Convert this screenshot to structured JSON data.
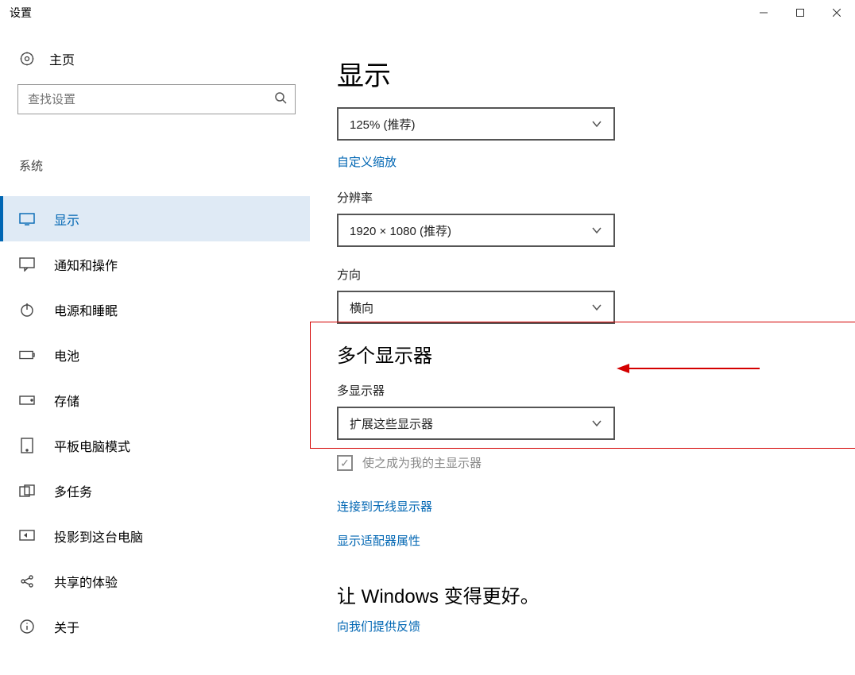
{
  "window": {
    "title": "设置"
  },
  "sidebar": {
    "home": "主页",
    "search_placeholder": "查找设置",
    "category": "系统",
    "items": [
      {
        "label": "显示",
        "icon": "monitor-icon",
        "active": true
      },
      {
        "label": "通知和操作",
        "icon": "message-icon"
      },
      {
        "label": "电源和睡眠",
        "icon": "power-icon"
      },
      {
        "label": "电池",
        "icon": "battery-icon"
      },
      {
        "label": "存储",
        "icon": "storage-icon"
      },
      {
        "label": "平板电脑模式",
        "icon": "tablet-icon"
      },
      {
        "label": "多任务",
        "icon": "multitask-icon"
      },
      {
        "label": "投影到这台电脑",
        "icon": "project-icon"
      },
      {
        "label": "共享的体验",
        "icon": "share-icon"
      },
      {
        "label": "关于",
        "icon": "info-icon"
      }
    ]
  },
  "main": {
    "title": "显示",
    "scale_value": "125% (推荐)",
    "custom_scaling_link": "自定义缩放",
    "resolution_label": "分辨率",
    "resolution_value": "1920 × 1080 (推荐)",
    "orientation_label": "方向",
    "orientation_value": "横向",
    "multi_heading": "多个显示器",
    "multi_label": "多显示器",
    "multi_value": "扩展这些显示器",
    "make_main_label": "使之成为我的主显示器",
    "connect_link": "连接到无线显示器",
    "adapter_link": "显示适配器属性",
    "better_heading": "让 Windows 变得更好。",
    "feedback_link": "向我们提供反馈"
  }
}
